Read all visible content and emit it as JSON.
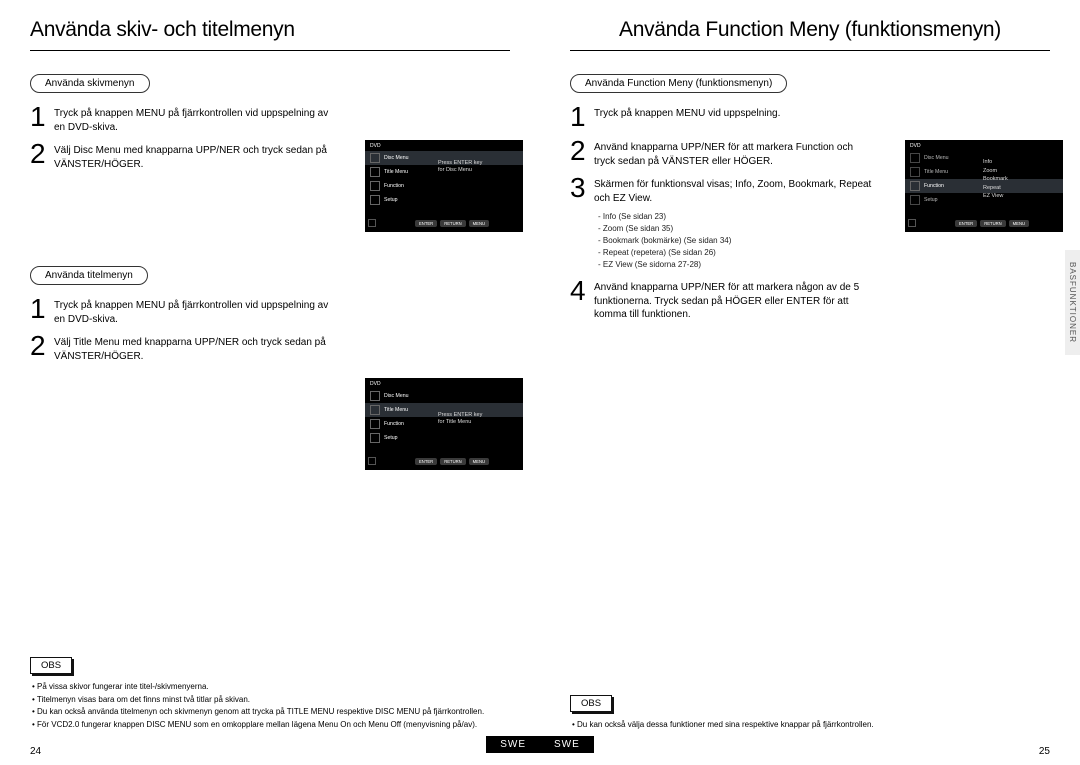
{
  "left": {
    "title": "Använda skiv- och titelmenyn",
    "section1_label": "Använda skivmenyn",
    "section1_steps": [
      "Tryck på knappen MENU på fjärrkontrollen vid uppspelning av en DVD-skiva.",
      "Välj Disc Menu med knapparna UPP/NER och tryck sedan på VÄNSTER/HÖGER."
    ],
    "section2_label": "Använda titelmenyn",
    "section2_steps": [
      "Tryck på knappen MENU på fjärrkontrollen vid uppspelning av en DVD-skiva.",
      "Välj Title Menu med knapparna UPP/NER och tryck sedan på VÄNSTER/HÖGER."
    ],
    "osd_top": "DVD",
    "osd_items": [
      "Disc Menu",
      "Title Menu",
      "Function",
      "Setup"
    ],
    "osd1_hint1": "Press ENTER key",
    "osd1_hint2": "for Disc Menu",
    "osd2_hint1": "Press ENTER key",
    "osd2_hint2": "for Title Menu",
    "osd_btns": [
      "ENTER",
      "RETURN",
      "MENU"
    ],
    "obs_label": "OBS",
    "obs": [
      "På vissa skivor fungerar inte titel-/skivmenyerna.",
      "Titelmenyn visas bara om det finns minst två titlar på skivan.",
      "Du kan också använda titelmenyn och skivmenyn genom att trycka på TITLE MENU respektive DISC MENU på fjärrkontrollen.",
      "För VCD2.0 fungerar knappen DISC MENU som en omkopplare mellan lägena Menu On och Menu Off (menyvisning på/av)."
    ],
    "page_num": "24",
    "lang": "SWE"
  },
  "right": {
    "title": "Använda Function Meny (funktionsmenyn)",
    "section_label": "Använda Function Meny (funktionsmenyn)",
    "steps": [
      "Tryck på knappen MENU vid uppspelning.",
      "Använd knapparna UPP/NER för att markera Function och tryck sedan på VÄNSTER eller HÖGER.",
      "Skärmen för funktionsval visas; Info, Zoom, Bookmark, Repeat och EZ View.",
      "Använd knapparna UPP/NER för att markera någon av de 5 funktionerna. Tryck sedan på HÖGER eller ENTER för att komma till funktionen."
    ],
    "sub_list": [
      "Info (Se sidan 23)",
      "Zoom (Se sidan 35)",
      "Bookmark (bokmärke) (Se sidan 34)",
      "Repeat (repetera) (Se sidan 26)",
      "EZ View (Se sidorna 27-28)"
    ],
    "osd_top": "DVD",
    "osd_items": [
      "Disc Menu",
      "Title Menu",
      "Function",
      "Setup"
    ],
    "fn_list": [
      "Info",
      "Zoom",
      "Bookmark",
      "Repeat",
      "EZ View"
    ],
    "osd_btns": [
      "ENTER",
      "RETURN",
      "MENU"
    ],
    "obs_label": "OBS",
    "obs": [
      "Du kan också välja dessa funktioner med sina respektive knappar på fjärrkontrollen."
    ],
    "page_num": "25",
    "lang": "SWE",
    "side_tab": "BASFUNKTIONER"
  }
}
